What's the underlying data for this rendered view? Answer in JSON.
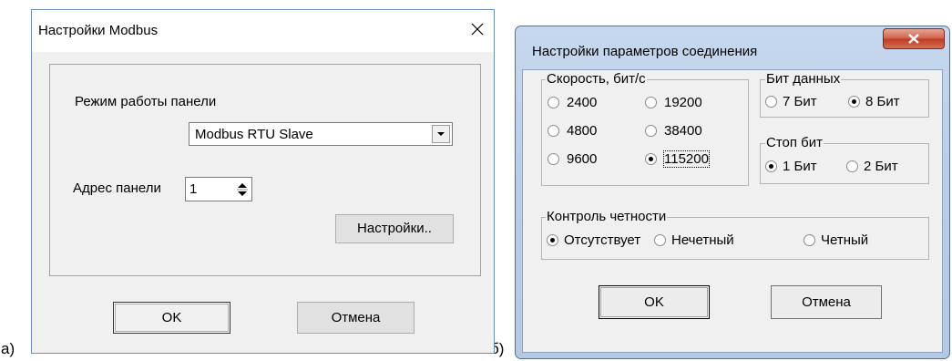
{
  "captions": {
    "a": "а)",
    "b": "б)"
  },
  "dialog_a": {
    "title": "Настройки Modbus",
    "mode_label": "Режим работы панели",
    "mode_value": "Modbus RTU Slave",
    "address_label": "Адрес панели",
    "address_value": "1",
    "settings_button": "Настройки..",
    "ok_button": "OK",
    "cancel_button": "Отмена"
  },
  "dialog_b": {
    "title": "Настройки параметров соединения",
    "speed": {
      "label": "Скорость, бит/с",
      "options": [
        "2400",
        "19200",
        "4800",
        "38400",
        "9600",
        "115200"
      ],
      "selected": "115200"
    },
    "data_bits": {
      "label": "Бит данных",
      "options": [
        "7 Бит",
        "8 Бит"
      ],
      "selected": "8 Бит"
    },
    "stop_bits": {
      "label": "Стоп бит",
      "options": [
        "1 Бит",
        "2 Бит"
      ],
      "selected": "1 Бит"
    },
    "parity": {
      "label": "Контроль четности",
      "options": [
        "Отсутствует",
        "Нечетный",
        "Четный"
      ],
      "selected": "Отсутствует"
    },
    "ok_button": "OK",
    "cancel_button": "Отмена"
  }
}
